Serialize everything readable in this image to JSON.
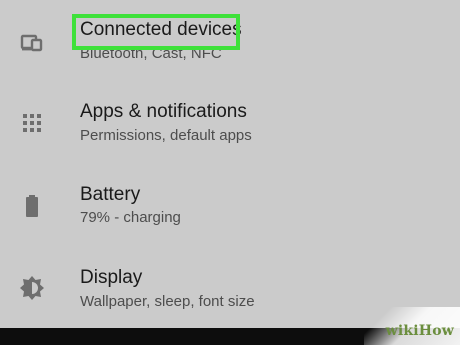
{
  "settings": {
    "items": [
      {
        "title": "Connected devices",
        "subtitle": "Bluetooth, Cast, NFC",
        "icon": "connected-devices-icon",
        "highlighted": true
      },
      {
        "title": "Apps & notifications",
        "subtitle": "Permissions, default apps",
        "icon": "apps-grid-icon"
      },
      {
        "title": "Battery",
        "subtitle": "79% - charging",
        "icon": "battery-icon"
      },
      {
        "title": "Display",
        "subtitle": "Wallpaper, sleep, font size",
        "icon": "brightness-icon"
      }
    ]
  },
  "colors": {
    "background": "#cbcbcb",
    "highlight": "#3ee13a",
    "title_text": "#1a1a1a",
    "subtitle_text": "#4d4d4d",
    "bottom_bar": "#0d0d0d"
  },
  "watermark": {
    "text": "wikiHow"
  }
}
